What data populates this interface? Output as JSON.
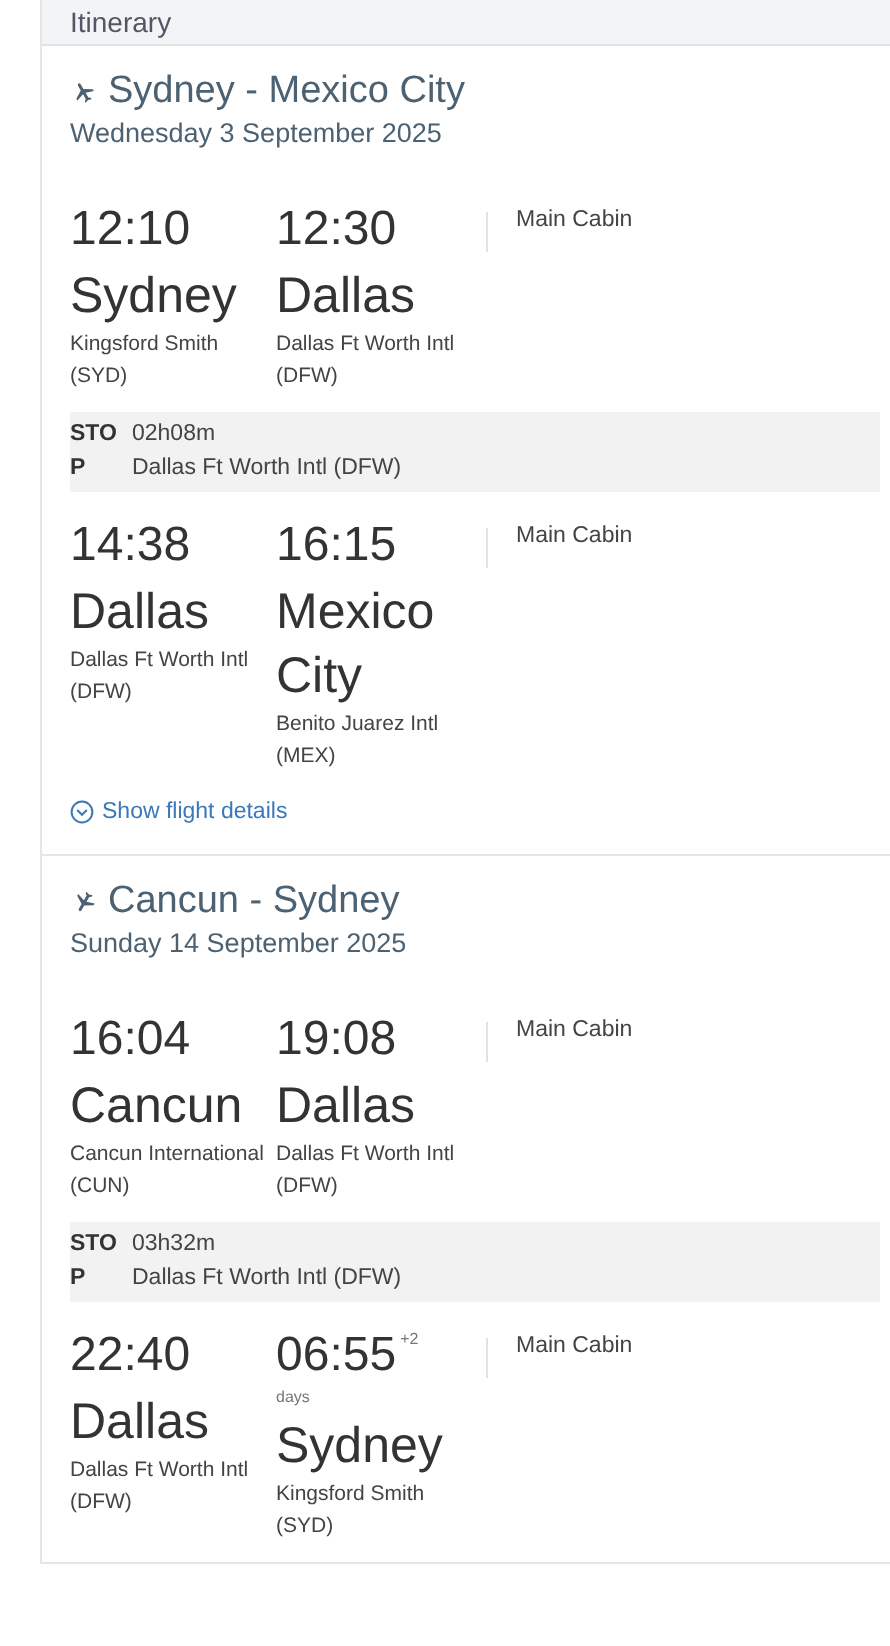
{
  "header": {
    "title": "Itinerary"
  },
  "flights": [
    {
      "kind": "outbound",
      "route": "Sydney - Mexico City",
      "date": "Wednesday 3 September 2025",
      "segments": [
        {
          "dep_time": "12:10",
          "dep_city": "Sydney",
          "dep_airport": "Kingsford Smith (SYD)",
          "arr_time": "12:30",
          "arr_city": "Dallas",
          "arr_airport": "Dallas Ft Worth Intl (DFW)",
          "cabin": "Main Cabin",
          "stop": {
            "label": "STOP",
            "duration": "02h08m",
            "place": "Dallas Ft Worth Intl (DFW)"
          }
        },
        {
          "dep_time": "14:38",
          "dep_city": "Dallas",
          "dep_airport": "Dallas Ft Worth Intl (DFW)",
          "arr_time": "16:15",
          "arr_city": "Mexico City",
          "arr_airport": "Benito Juarez Intl (MEX)",
          "cabin": "Main Cabin"
        }
      ],
      "details_link": "Show flight details"
    },
    {
      "kind": "inbound",
      "route": "Cancun - Sydney",
      "date": "Sunday 14 September 2025",
      "segments": [
        {
          "dep_time": "16:04",
          "dep_city": "Cancun",
          "dep_airport": "Cancun International (CUN)",
          "arr_time": "19:08",
          "arr_city": "Dallas",
          "arr_airport": "Dallas Ft Worth Intl (DFW)",
          "cabin": "Main Cabin",
          "stop": {
            "label": "STOP",
            "duration": "03h32m",
            "place": "Dallas Ft Worth Intl (DFW)"
          }
        },
        {
          "dep_time": "22:40",
          "dep_city": "Dallas",
          "dep_airport": "Dallas Ft Worth Intl (DFW)",
          "arr_time": "06:55",
          "arr_offset": "+2",
          "arr_offset_unit": "days",
          "arr_city": "Sydney",
          "arr_airport": "Kingsford Smith (SYD)",
          "cabin": "Main Cabin"
        }
      ]
    }
  ]
}
